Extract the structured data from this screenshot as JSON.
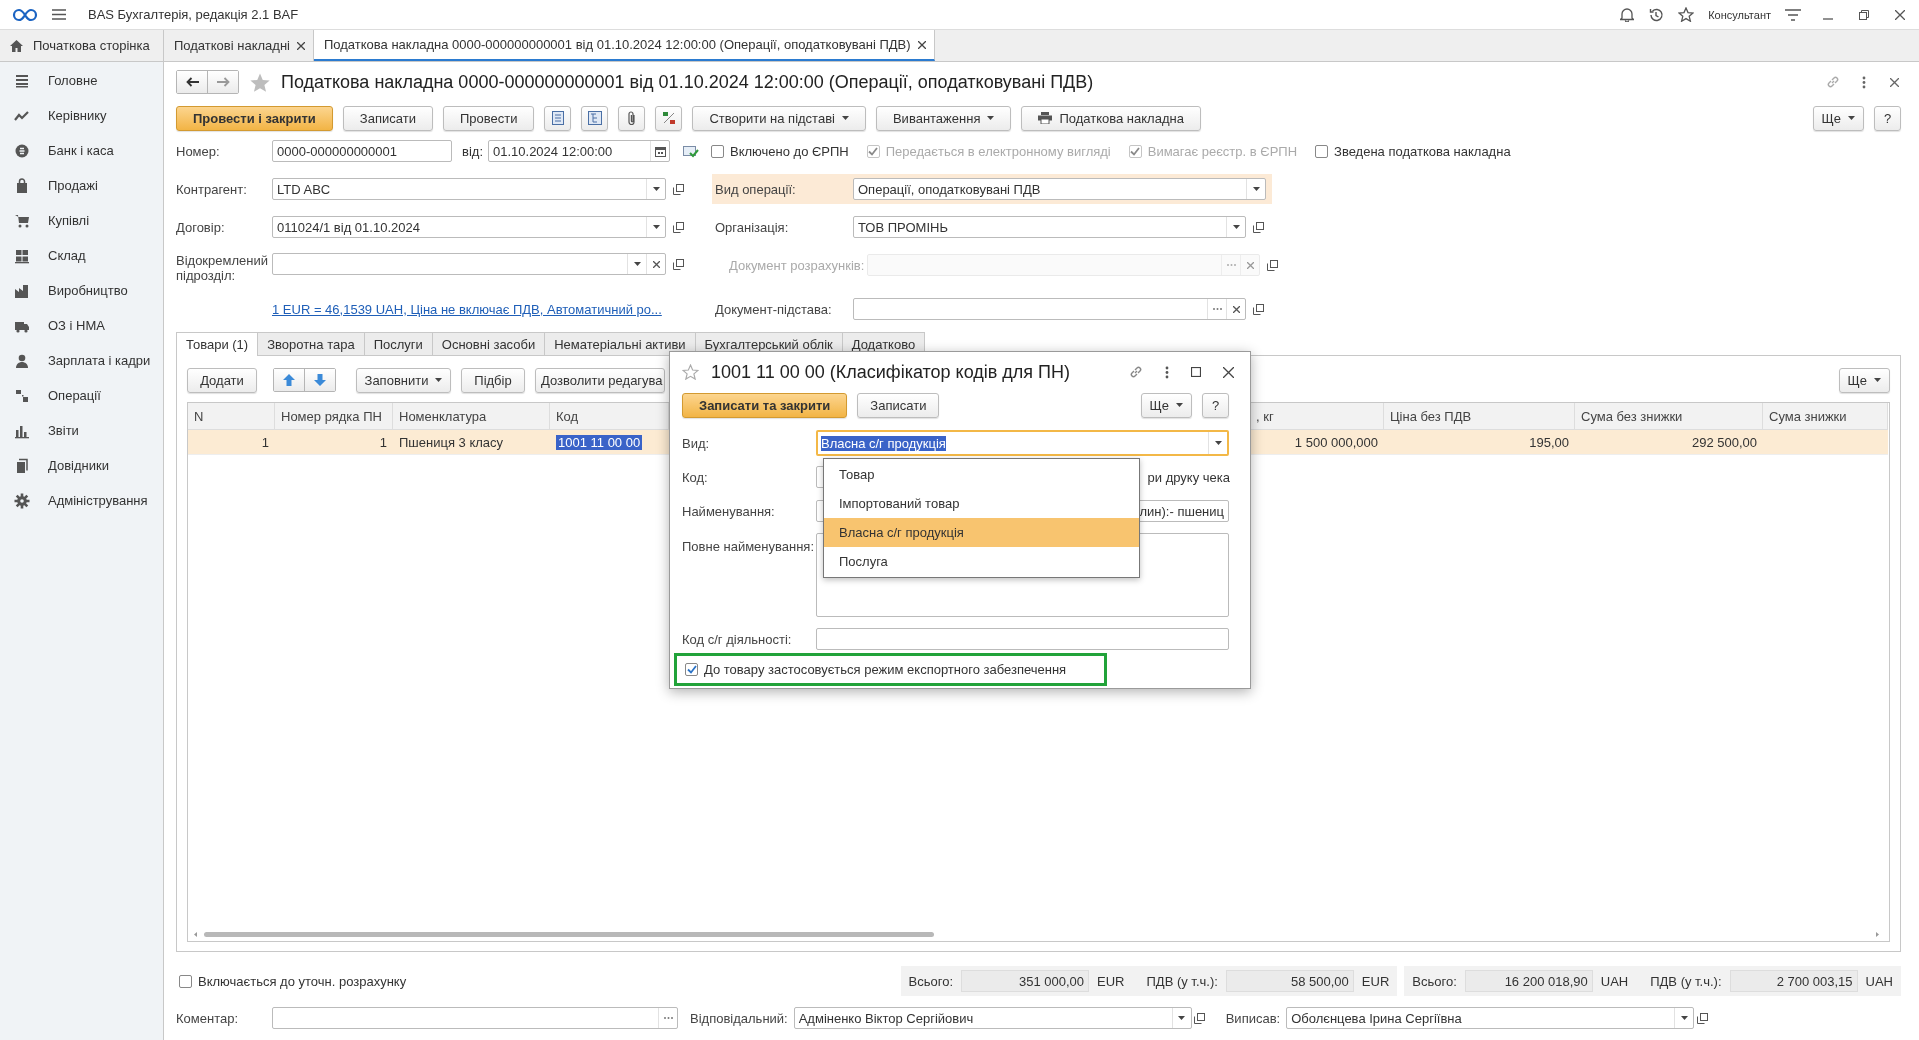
{
  "app": {
    "title": "BAS Бухгалтерія, редакція 2.1 BAF",
    "user": "Консультант"
  },
  "open_tabs": [
    {
      "kind": "home",
      "label": "Початкова сторінка",
      "selected": false
    },
    {
      "kind": "tab",
      "label": "Податкові накладні",
      "selected": false
    },
    {
      "kind": "tab",
      "label": "Податкова накладна 0000-000000000001 від 01.10.2024 12:00:00 (Операції, оподатковувані ПДВ)",
      "selected": true
    }
  ],
  "sidebar": [
    "Головне",
    "Керівнику",
    "Банк і каса",
    "Продажі",
    "Купівлі",
    "Склад",
    "Виробництво",
    "ОЗ і НМА",
    "Зарплата і кадри",
    "Операції",
    "Звіти",
    "Довідники",
    "Адміністрування"
  ],
  "document": {
    "title": "Податкова накладна 0000-000000000001 від 01.10.2024 12:00:00 (Операції, оподатковувані ПДВ)",
    "buttons": [
      {
        "kind": "primary",
        "label": "Провести і закрити"
      },
      {
        "kind": "plain",
        "label": "Записати"
      },
      {
        "kind": "plain",
        "label": "Провести"
      }
    ],
    "menus": [
      {
        "kind": "menu",
        "label": "Створити на підставі"
      },
      {
        "kind": "menu",
        "label": "Вивантаження"
      },
      {
        "kind": "print",
        "label": "Податкова накладна"
      }
    ],
    "more": "Ще",
    "help": "?",
    "number": {
      "label": "Номер:",
      "value": "0000-000000000001"
    },
    "date": {
      "label": "від:",
      "value": "01.10.2024 12:00:00"
    },
    "flags": [
      {
        "label": "Включено до ЄРПН",
        "checked": false,
        "disabled": false
      },
      {
        "label": "Передається в електронному вигляді",
        "checked": true,
        "disabled": true
      },
      {
        "label": "Вимагає реєстр. в ЄРПН",
        "checked": true,
        "disabled": true
      },
      {
        "label": "Зведена податкова накладна",
        "checked": false,
        "disabled": false
      }
    ],
    "left_fields": [
      {
        "label": "Контрагент:",
        "value": "LTD ABC",
        "kind": "select"
      },
      {
        "label": "Договір:",
        "value": "011024/1 від 01.10.2024",
        "kind": "select"
      },
      {
        "label": "Відокремлений підрозділ:",
        "kind": "select-clear"
      }
    ],
    "rate_link": "1 EUR = 46,1539 UAH, Ціна не включає ПДВ, Автоматичний ро...",
    "right_fields": [
      {
        "label": "Вид операції:",
        "value": "Операції, оподатковувані ПДВ",
        "kind": "choice",
        "highlighted": true,
        "disabled": false
      },
      {
        "label": "Організація:",
        "value": "ТОВ ПРОМІНЬ",
        "kind": "select",
        "highlighted": false,
        "disabled": false
      },
      {
        "label": "Документ розрахунків:",
        "kind": "lookup",
        "highlighted": false,
        "disabled": true
      },
      {
        "label": "Документ-підстава:",
        "kind": "lookup",
        "highlighted": false,
        "disabled": false
      }
    ],
    "tabs": [
      {
        "label": "Товари (1)",
        "selected": true
      },
      {
        "label": "Зворотна тара",
        "selected": false
      },
      {
        "label": "Послуги",
        "selected": false
      },
      {
        "label": "Основні засоби",
        "selected": false
      },
      {
        "label": "Нематеріальні активи",
        "selected": false
      },
      {
        "label": "Бухгалтерський облік",
        "selected": false
      },
      {
        "label": "Додатково",
        "selected": false
      }
    ],
    "table_toolbar": {
      "add": "Додати",
      "fill": "Заповнити",
      "pick": "Підбір",
      "edit": "Дозволити редагува",
      "more": "Ще"
    },
    "table": {
      "columns": [
        "N",
        "Номер рядка ПН",
        "Номенклатура",
        "Код",
        ", кг",
        "Ціна без ПДВ",
        "Сума без знижки",
        "Сума знижки"
      ],
      "rows": [
        {
          "cells": [
            "1",
            "1",
            "Пшениця 3 класу",
            "1001 11 00 00",
            "1 500 000,000",
            "195,00",
            "292 500,00"
          ],
          "selected": true
        }
      ]
    },
    "footer": {
      "recalc": {
        "label": "Включається до уточн. розрахунку",
        "checked": false
      },
      "totals": [
        {
          "total_label": "Всього:",
          "total": "351 000,00",
          "currency": "EUR",
          "vat_label": "ПДВ (у т.ч.):",
          "vat": "58 500,00",
          "vat_currency": "EUR"
        },
        {
          "total_label": "Всього:",
          "total": "16 200 018,90",
          "currency": "UAH",
          "vat_label": "ПДВ (у т.ч.):",
          "vat": "2 700 003,15",
          "vat_currency": "UAH"
        }
      ],
      "comment": {
        "label": "Коментар:"
      },
      "responsible": {
        "label": "Відповідальний:",
        "value": "Адміненко Віктор Сергійович"
      },
      "issued_by": {
        "label": "Виписав:",
        "value": "Оболєнцева Ірина Сергіївна"
      }
    }
  },
  "dialog": {
    "title": "1001 11 00 00 (Класифікатор кодів для ПН)",
    "save_close": "Записати та закрити",
    "save": "Записати",
    "more": "Ще",
    "help": "?",
    "kind_field": {
      "label": "Вид:",
      "value": "Власна с/г продукція"
    },
    "code": {
      "label": "Код:",
      "note": "ри друку чека"
    },
    "name": {
      "label": "Найменування:",
      "value": "лин):- пшениц"
    },
    "full_name": {
      "label": "Повне найменування:"
    },
    "activity_code": {
      "label": "Код с/г діяльності:"
    },
    "export": {
      "label": "До товару застосовується режим експортного забезпечення",
      "checked": true,
      "highlighted": true
    },
    "options": [
      {
        "label": "Товар",
        "selected": false
      },
      {
        "label": "Імпортований товар",
        "selected": false
      },
      {
        "label": "Власна с/г продукція",
        "selected": true
      },
      {
        "label": "Послуга",
        "selected": false
      }
    ]
  }
}
